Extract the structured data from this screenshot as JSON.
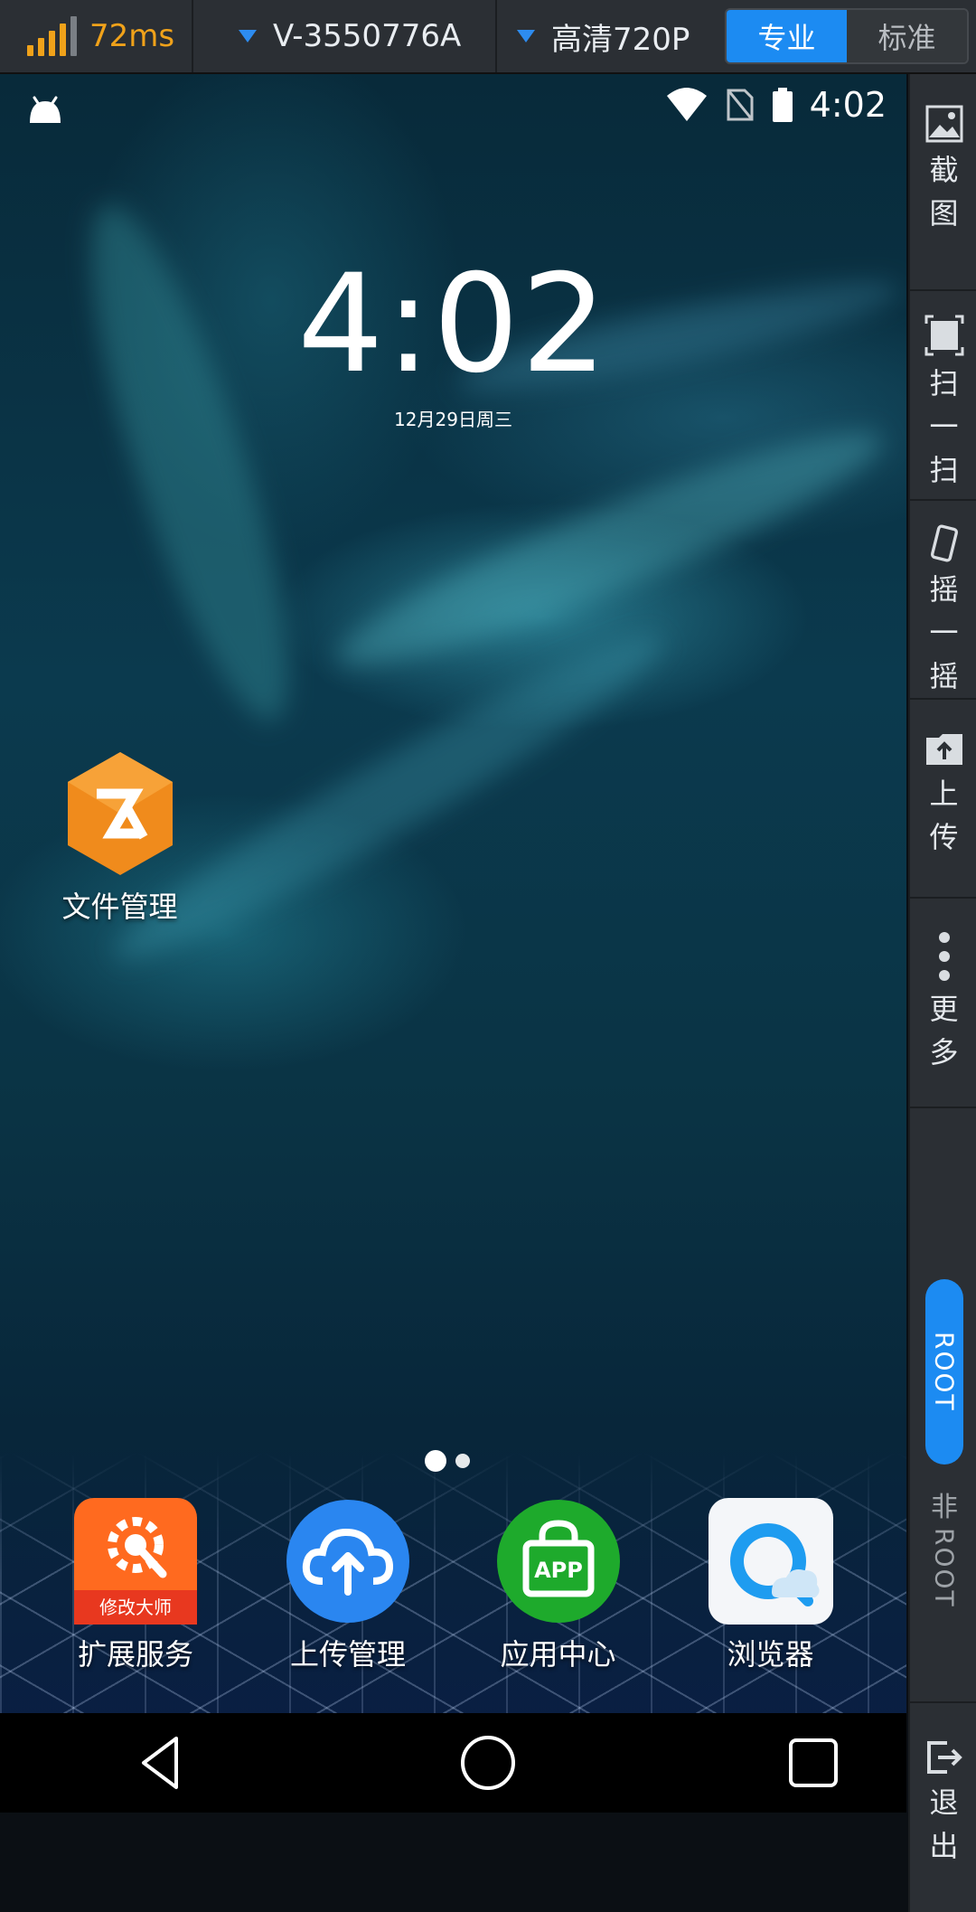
{
  "toolbar": {
    "latency": "72ms",
    "device": "V-3550776A",
    "quality": "高清720P",
    "mode_pro": "专业",
    "mode_std": "标准",
    "signal_icon": "signal-bars-icon",
    "accent": "#1c8bf2",
    "latency_color": "#f0a21a"
  },
  "status_bar": {
    "time": "4:02"
  },
  "lock": {
    "time": "4:02",
    "date": "12月29日周三"
  },
  "desktop": {
    "apps": [
      {
        "label": "文件管理",
        "icon": "file-manager-icon"
      }
    ],
    "dock": [
      {
        "label": "扩展服务",
        "icon": "extension-service-icon",
        "badge": "修改大师"
      },
      {
        "label": "上传管理",
        "icon": "upload-manager-icon"
      },
      {
        "label": "应用中心",
        "icon": "app-center-icon",
        "badge": "APP"
      },
      {
        "label": "浏览器",
        "icon": "browser-icon"
      }
    ],
    "page_count": 2,
    "active_page": 1
  },
  "sidebar": {
    "items": [
      {
        "label": "截图",
        "icon": "screenshot-icon"
      },
      {
        "label": "扫一扫",
        "icon": "scan-icon"
      },
      {
        "label": "摇一摇",
        "icon": "shake-icon"
      },
      {
        "label": "上传",
        "icon": "upload-icon"
      },
      {
        "label": "更多",
        "icon": "more-icon"
      }
    ],
    "root_on": "ROOT",
    "root_off_prefix": "非",
    "root_off": "ROOT",
    "exit": {
      "label": "退出",
      "icon": "exit-icon"
    }
  }
}
